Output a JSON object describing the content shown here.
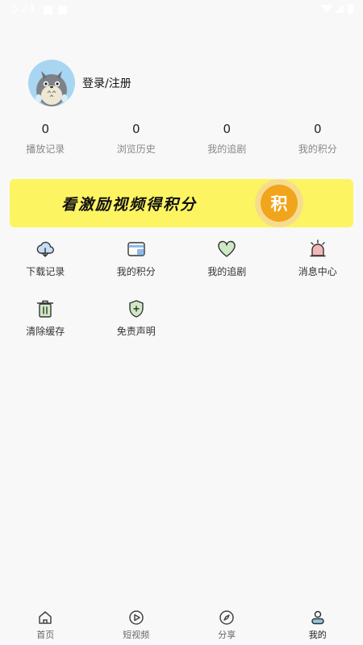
{
  "status_bar": {
    "time": "5:24"
  },
  "profile": {
    "login_label": "登录/注册"
  },
  "stats": [
    {
      "value": "0",
      "label": "播放记录"
    },
    {
      "value": "0",
      "label": "浏览历史"
    },
    {
      "value": "0",
      "label": "我的追剧"
    },
    {
      "value": "0",
      "label": "我的积分"
    }
  ],
  "banner": {
    "text": "看激励视频得积分",
    "coin_char": "积"
  },
  "menu": [
    {
      "label": "下载记录",
      "icon": "cloud-download-icon"
    },
    {
      "label": "我的积分",
      "icon": "wallet-card-icon"
    },
    {
      "label": "我的追剧",
      "icon": "heart-icon"
    },
    {
      "label": "消息中心",
      "icon": "alarm-bell-icon"
    },
    {
      "label": "清除缓存",
      "icon": "trash-icon"
    },
    {
      "label": "免责声明",
      "icon": "shield-plus-icon"
    }
  ],
  "tabs": [
    {
      "label": "首页",
      "icon": "home-icon"
    },
    {
      "label": "短视频",
      "icon": "play-circle-icon"
    },
    {
      "label": "分享",
      "icon": "compass-icon"
    },
    {
      "label": "我的",
      "icon": "user-icon",
      "active": true
    }
  ],
  "colors": {
    "banner": "#fdf462",
    "coin": "#f1a51c",
    "accent_blue": "#8fb9ea",
    "accent_green": "#cfe9c4",
    "accent_pink": "#f3b7b7"
  }
}
